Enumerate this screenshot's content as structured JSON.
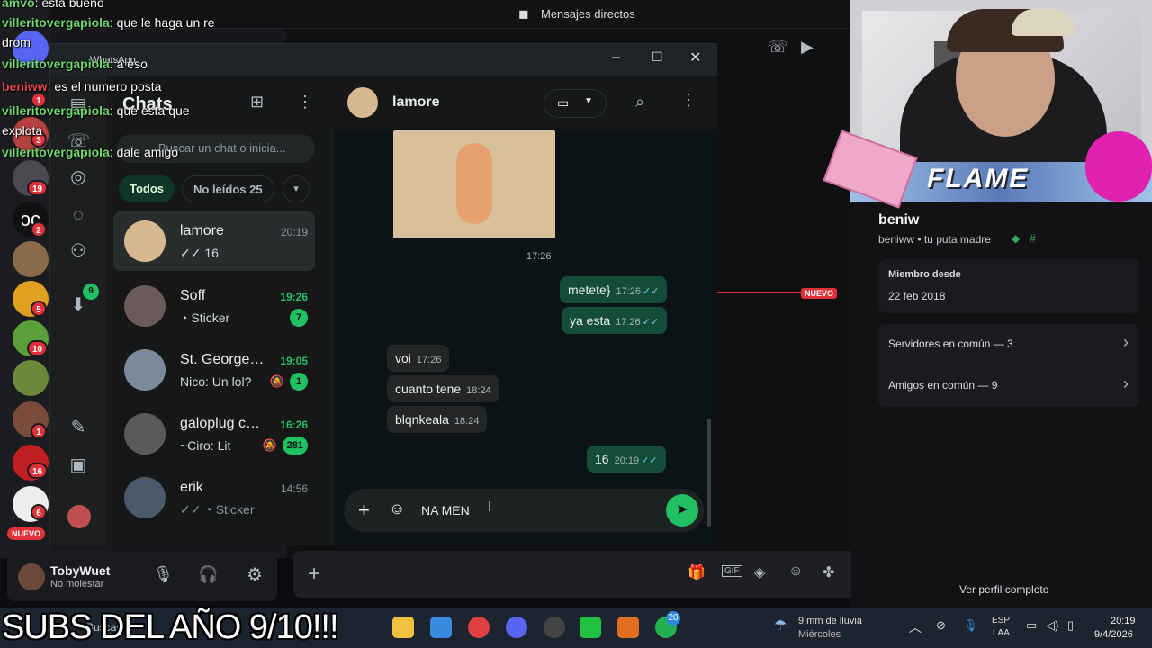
{
  "overlay_chat": [
    {
      "user": "amvo",
      "text": ": esta bueno",
      "user_color": "green"
    },
    {
      "user": "villeritovergapiola",
      "text": ": que le haga un re",
      "user_color": "green"
    },
    {
      "user": "",
      "text": "drom",
      "user_color": "green"
    },
    {
      "user": "villeritovergapiola",
      "text": ": a eso",
      "user_color": "green"
    },
    {
      "user": "beniww",
      "text": ": es el numero posta",
      "user_color": "red"
    },
    {
      "user": "villeritovergapiola",
      "text": ": que esta que",
      "user_color": "green"
    },
    {
      "user": "",
      "text": "explota",
      "user_color": "green"
    },
    {
      "user": "villeritovergapiola",
      "text": ": dale amigo",
      "user_color": "green"
    }
  ],
  "discord": {
    "header_title": "Mensajes directos",
    "new_badge": "NUEVO",
    "rail_new_badge": "NUEVO",
    "rail_badges": [
      "1",
      "3",
      "19",
      "2",
      "5",
      "10",
      "1",
      "16",
      "6"
    ],
    "user": {
      "name": "TobyWuet",
      "status": "No molestar"
    },
    "profile": {
      "display_name": "beniw",
      "username_line": "beniww • tu puta madre",
      "member_since_label": "Miembro desde",
      "member_since_value": "22 feb 2018",
      "servers_common": "Servidores en común — 3",
      "friends_common": "Amigos en común — 9",
      "full_profile": "Ver perfil completo"
    }
  },
  "whatsapp": {
    "window_title": "WhatsApp",
    "nav_badge": "9",
    "list": {
      "title": "Chats",
      "search_placeholder": "Buscar un chat o inicia...",
      "filters": {
        "all": "Todos",
        "unread": "No leídos 25"
      },
      "chats": [
        {
          "name": "lamore",
          "time": "20:19",
          "preview": "✓✓ 16",
          "unread": "",
          "muted": false,
          "time_green": false
        },
        {
          "name": "Soff",
          "time": "19:26",
          "preview": "Sticker",
          "unread": "7",
          "muted": false,
          "time_green": true
        },
        {
          "name": "St. George's ...",
          "time": "19:05",
          "preview": "Nico: Un lol?",
          "unread": "1",
          "muted": true,
          "time_green": true
        },
        {
          "name": "galoplug cum...",
          "time": "16:26",
          "preview": "~Ciro: Lit",
          "unread": "281",
          "muted": true,
          "time_green": true
        },
        {
          "name": "erik",
          "time": "14:56",
          "preview": "Sticker",
          "unread": "",
          "muted": false,
          "time_green": false
        }
      ]
    },
    "conversation": {
      "contact": "lamore",
      "sticker_time": "17:26",
      "messages": [
        {
          "dir": "out",
          "text": "metete}",
          "time": "17:26"
        },
        {
          "dir": "out",
          "text": "ya esta",
          "time": "17:26"
        },
        {
          "dir": "in",
          "text": "voi",
          "time": "17:26"
        },
        {
          "dir": "in",
          "text": "cuanto tene",
          "time": "18:24"
        },
        {
          "dir": "in",
          "text": "blqnkeala",
          "time": "18:24"
        },
        {
          "dir": "out",
          "text": "16",
          "time": "20:19"
        }
      ],
      "composer_value": "NA MEN"
    }
  },
  "stream_caption": "SUBS DEL AÑO 9/10!!!",
  "webcam_banner": "FLAME",
  "taskbar": {
    "search_label": "Buscar",
    "whatsapp_badge": "20",
    "weather_line1": "9 mm de lluvia",
    "weather_line2": "Miércoles",
    "lang_line1": "ESP",
    "lang_line2": "LAA",
    "time": "20:19",
    "date": "9/4/2026"
  },
  "colors": {
    "wa_green": "#21c063",
    "wa_outgoing": "#144d37",
    "discord_red": "#e0303a"
  }
}
